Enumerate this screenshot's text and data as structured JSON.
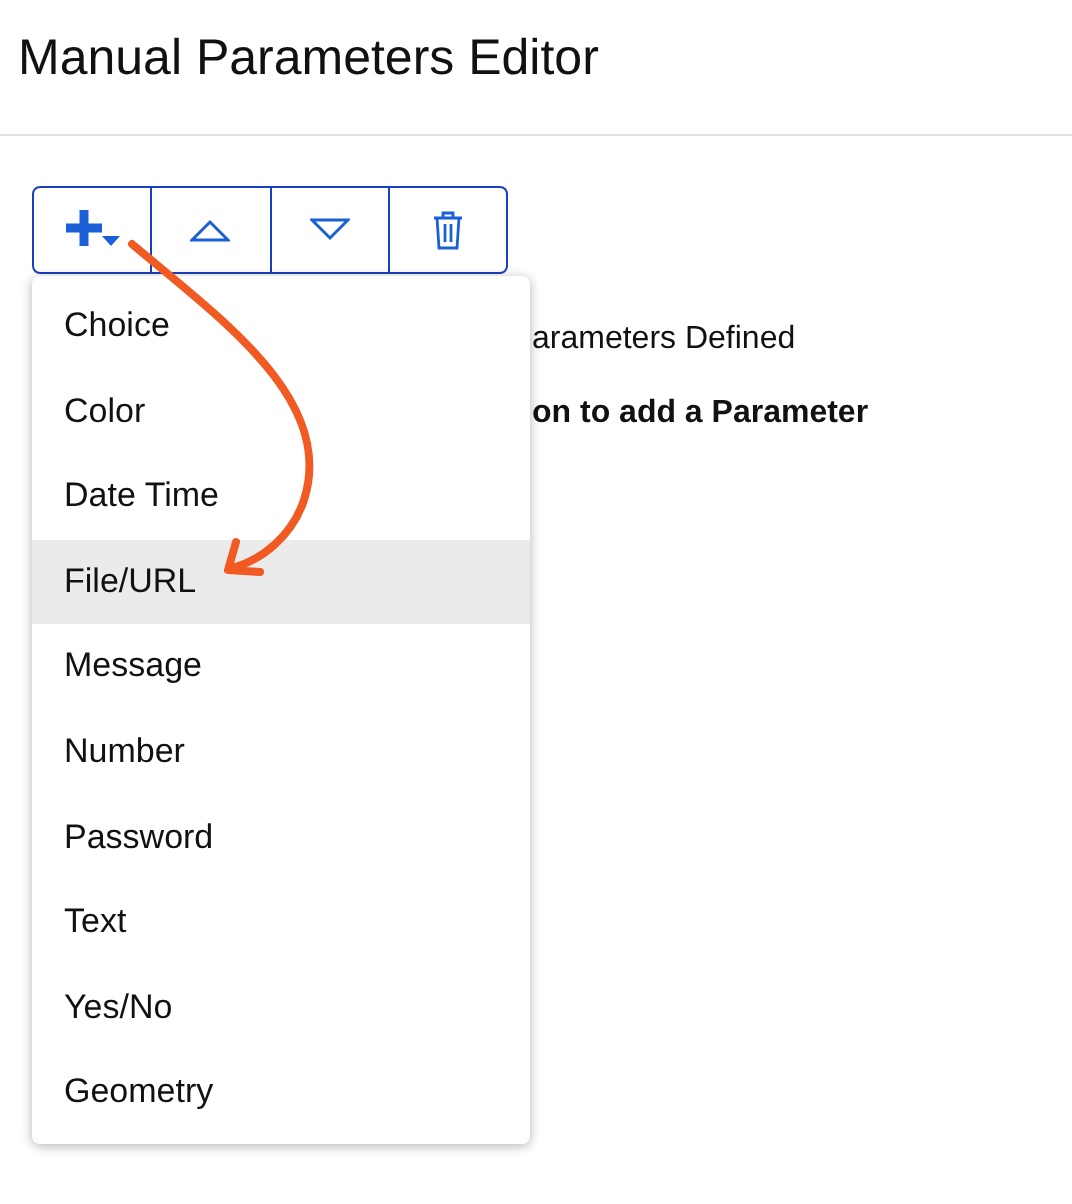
{
  "title": "Manual Parameters Editor",
  "toolbar": [
    {
      "kind": "add"
    },
    {
      "kind": "up"
    },
    {
      "kind": "down"
    },
    {
      "kind": "delete"
    }
  ],
  "messages": [
    {
      "text": "arameters Defined",
      "bold": false
    },
    {
      "text": "on to add a Parameter",
      "bold": true
    }
  ],
  "menu": [
    {
      "label": "Choice",
      "selected": false
    },
    {
      "label": "Color",
      "selected": false
    },
    {
      "label": "Date Time",
      "selected": false
    },
    {
      "label": "File/URL",
      "selected": true
    },
    {
      "label": "Message",
      "selected": false
    },
    {
      "label": "Number",
      "selected": false
    },
    {
      "label": "Password",
      "selected": false
    },
    {
      "label": "Text",
      "selected": false
    },
    {
      "label": "Yes/No",
      "selected": false
    },
    {
      "label": "Geometry",
      "selected": false
    }
  ],
  "annotation": {
    "kind": "arrow"
  }
}
